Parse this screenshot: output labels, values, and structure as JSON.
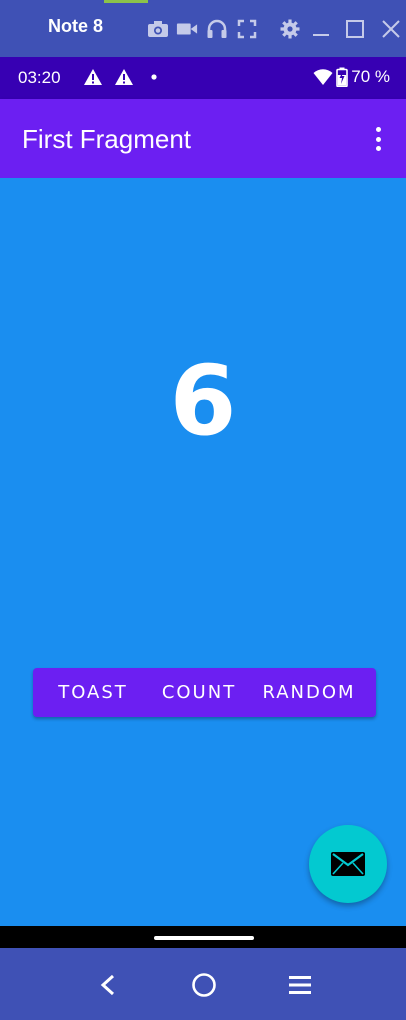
{
  "emulator": {
    "title": "Note 8",
    "toolbar_icons": [
      "camera-icon",
      "video-icon",
      "headphones-icon",
      "fullscreen-icon",
      "gear-icon",
      "minimize-icon",
      "maximize-icon",
      "close-icon"
    ]
  },
  "status_bar": {
    "time": "03:20",
    "battery": "70 %",
    "icons": [
      "warning-icon",
      "warning-icon",
      "notification-dot",
      "wifi-icon",
      "battery-charging-icon"
    ]
  },
  "app_bar": {
    "title": "First Fragment",
    "menu_icon": "overflow-menu-icon"
  },
  "main": {
    "count": "6",
    "buttons": {
      "toast": "TOAST",
      "count": "COUNT",
      "random": "RANDOM"
    },
    "fab_icon": "mail-icon"
  },
  "nav_bar": {
    "icons": [
      "back-icon",
      "home-icon",
      "menu-icon"
    ]
  },
  "colors": {
    "emulator_chrome": "#3f51b5",
    "status_bar": "#3700b3",
    "app_bar": "#6c1ff2",
    "content_bg": "#1a8ef0",
    "fab": "#03c9d0"
  }
}
